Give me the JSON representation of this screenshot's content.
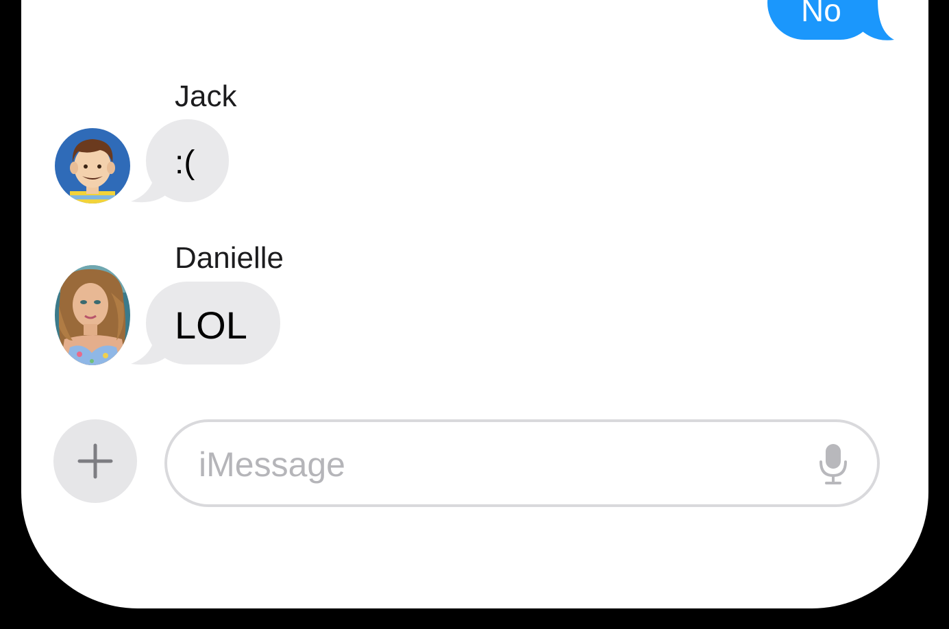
{
  "conversation": {
    "outgoing": [
      {
        "text": "No",
        "color": "#1b97fc"
      }
    ],
    "incoming": [
      {
        "sender": "Jack",
        "text": ":(",
        "avatar": "cartoon-avatar-jack"
      },
      {
        "sender": "Danielle",
        "text": "LOL",
        "avatar": "photo-avatar-danielle"
      }
    ],
    "incoming_bubble_color": "#e9e9eb"
  },
  "composer": {
    "add_icon": "plus-icon",
    "placeholder": "iMessage",
    "mic_icon": "microphone-icon"
  }
}
